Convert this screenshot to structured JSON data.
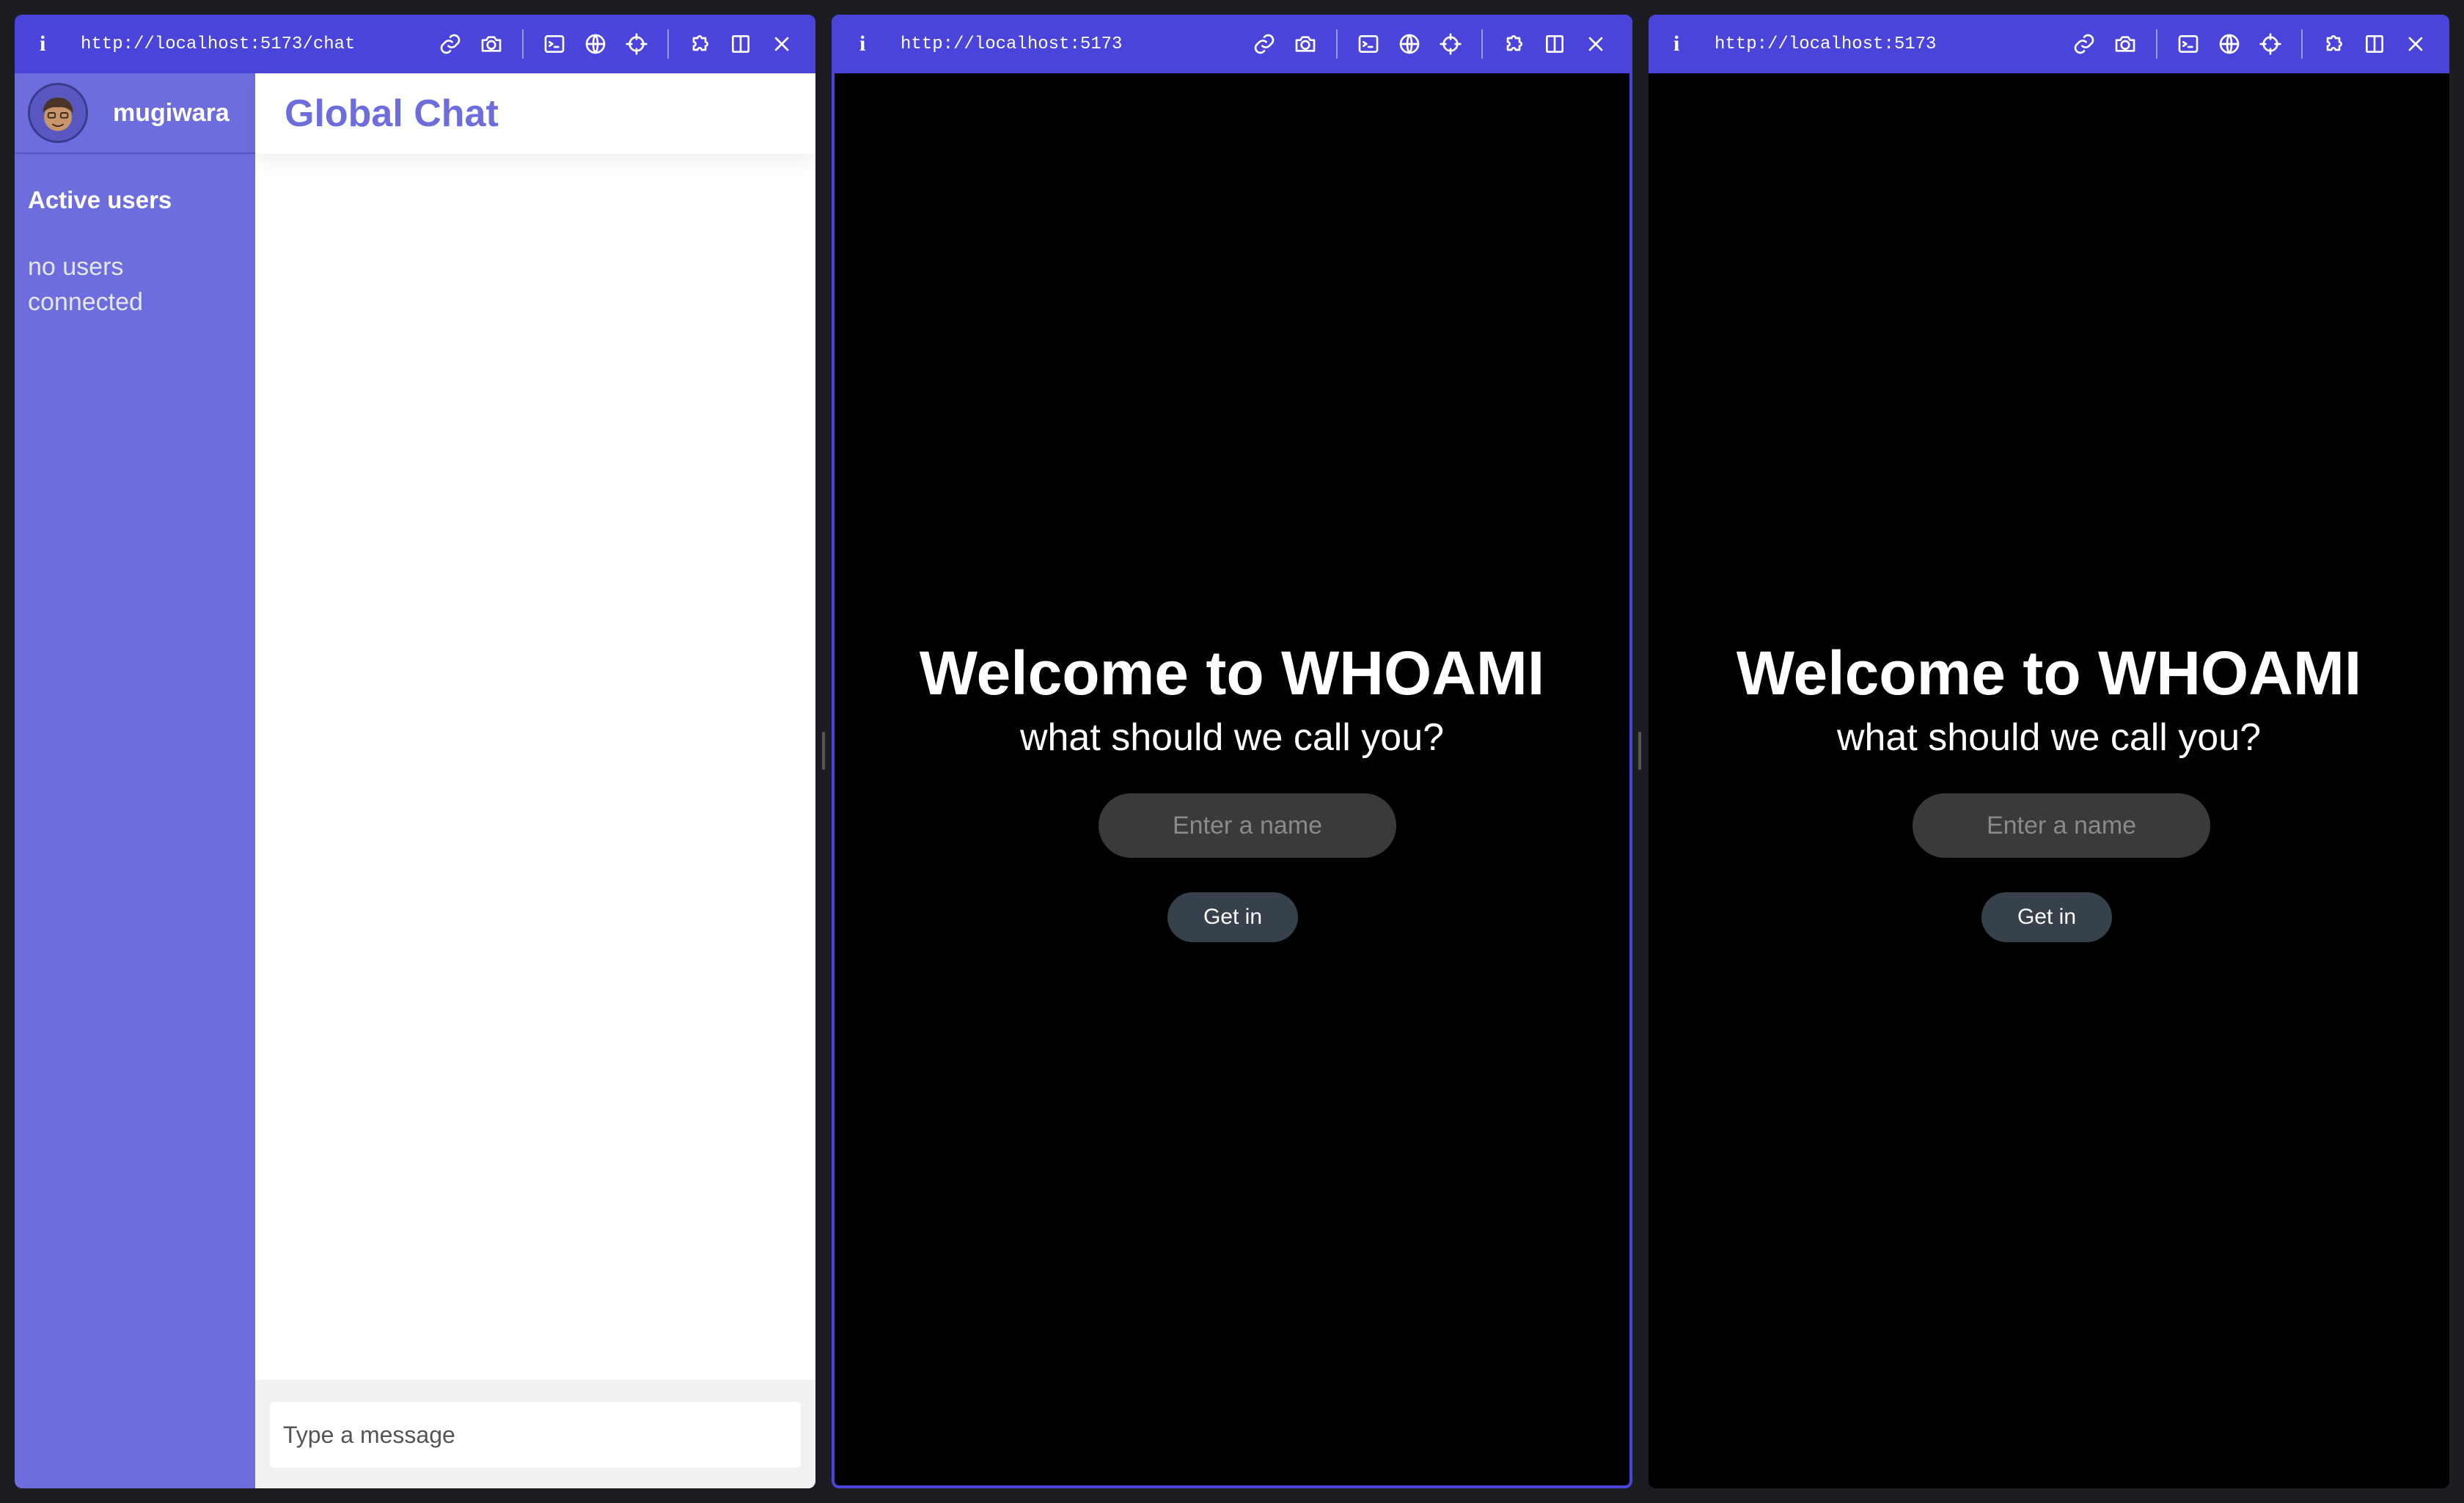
{
  "panes": [
    {
      "url": "http://localhost:5173/chat",
      "app": {
        "user": {
          "name": "mugiwara",
          "avatar_icon": "avatar-face-icon"
        },
        "active_users_title": "Active users",
        "no_users_text": "no users connected",
        "chat_title": "Global Chat",
        "message_placeholder": "Type a message"
      }
    },
    {
      "url": "http://localhost:5173",
      "app": {
        "title": "Welcome to WHOAMI",
        "subtitle": "what should we call you?",
        "name_placeholder": "Enter a name",
        "button_label": "Get in"
      }
    },
    {
      "url": "http://localhost:5173",
      "app": {
        "title": "Welcome to WHOAMI",
        "subtitle": "what should we call you?",
        "name_placeholder": "Enter a name",
        "button_label": "Get in"
      }
    }
  ],
  "toolbar": {
    "info_label": "i",
    "icons": [
      "link-icon",
      "camera-icon",
      "terminal-icon",
      "globe-icon",
      "crosshair-icon",
      "puzzle-icon",
      "split-view-icon",
      "close-icon"
    ]
  },
  "colors": {
    "accent": "#4b44db",
    "sidebar": "#6e6ddd",
    "chat_title": "#6e6ddd",
    "page_background": "#000000",
    "input_background": "#3a3a3a",
    "button_background": "#37414b"
  }
}
